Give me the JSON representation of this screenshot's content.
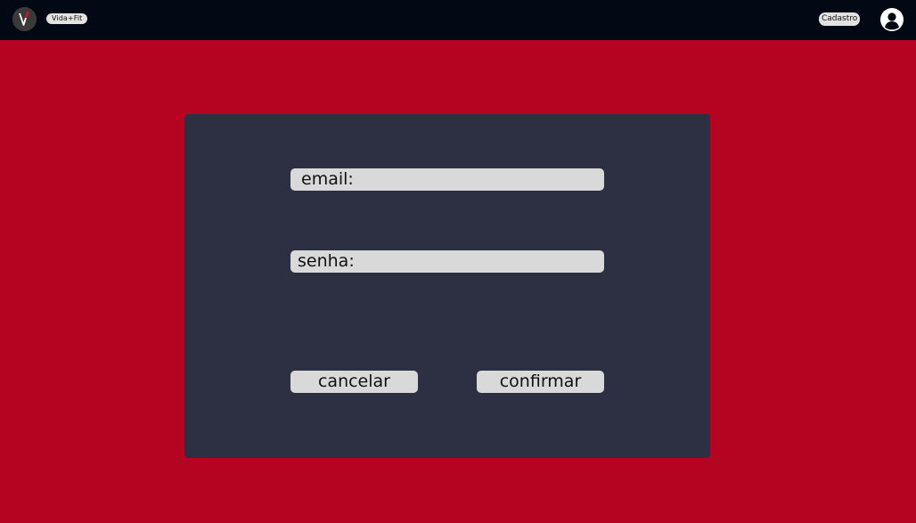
{
  "header": {
    "brand_label": "Vida+Fit",
    "signup_label": "Cadastro",
    "logo_letter": "V",
    "logo_icon": "vidafit-logo-icon",
    "account_icon": "user-account-icon"
  },
  "form": {
    "email_label": "email:",
    "email_value": "",
    "password_label": "senha:",
    "password_value": "",
    "cancel_label": "cancelar",
    "confirm_label": "confirmar"
  },
  "colors": {
    "topbar": "#020814",
    "background": "#b40421",
    "panel": "#2d2f43",
    "control": "#d9d9d9"
  }
}
